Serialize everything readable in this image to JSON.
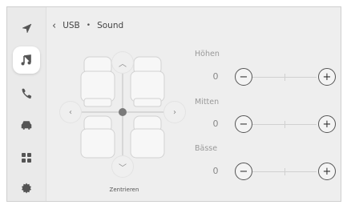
{
  "breadcrumb": {
    "source": "USB",
    "separator": "•",
    "page": "Sound"
  },
  "sidebar": {
    "items": [
      {
        "id": "navigation",
        "icon": "navigation-arrow-icon",
        "active": false
      },
      {
        "id": "media",
        "icon": "music-note-icon",
        "active": true
      },
      {
        "id": "phone",
        "icon": "phone-icon",
        "active": false
      },
      {
        "id": "vehicle",
        "icon": "car-icon",
        "active": false
      },
      {
        "id": "apps",
        "icon": "apps-grid-icon",
        "active": false
      },
      {
        "id": "settings",
        "icon": "gear-icon",
        "active": false
      }
    ]
  },
  "balance": {
    "center_label": "Zentrieren"
  },
  "equalizer": [
    {
      "label": "Höhen",
      "value": "0",
      "minus": "−",
      "plus": "+"
    },
    {
      "label": "Mitten",
      "value": "0",
      "minus": "−",
      "plus": "+"
    },
    {
      "label": "Bässe",
      "value": "0",
      "minus": "−",
      "plus": "+"
    }
  ],
  "colors": {
    "background": "#eeeeee",
    "sidebar": "#eaeaea",
    "active_item": "#ffffff",
    "icon": "#555555"
  }
}
